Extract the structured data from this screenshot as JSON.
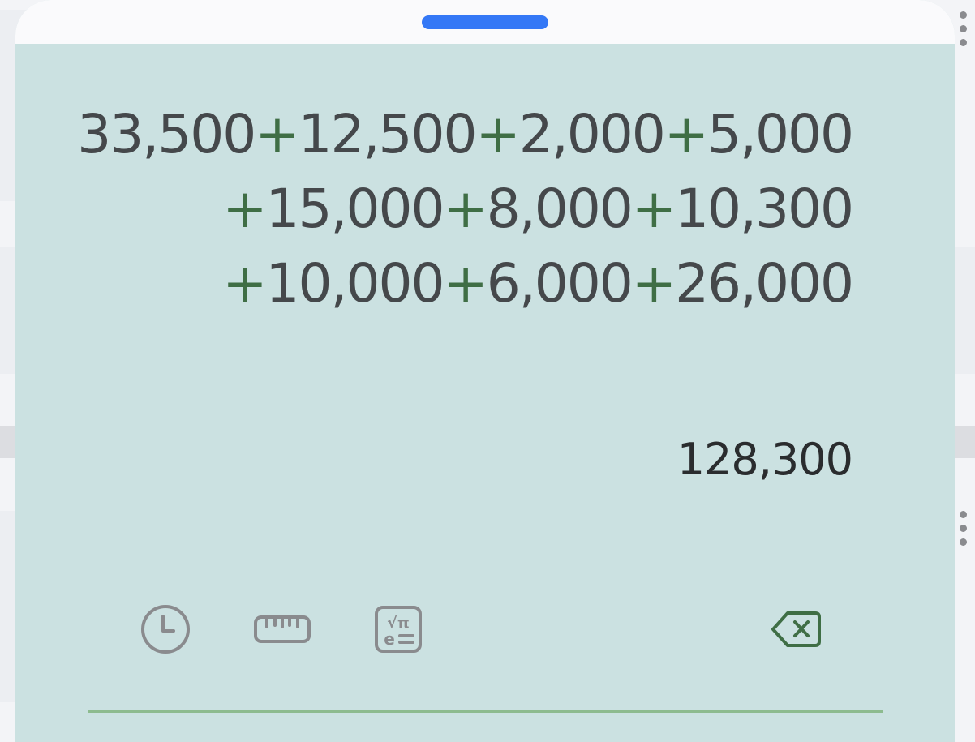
{
  "calculator": {
    "expression_lines": [
      [
        {
          "t": "num",
          "v": "33,500"
        },
        {
          "t": "op",
          "v": "+"
        },
        {
          "t": "num",
          "v": "12,500"
        },
        {
          "t": "op",
          "v": "+"
        },
        {
          "t": "num",
          "v": "2,000"
        },
        {
          "t": "op",
          "v": "+"
        },
        {
          "t": "num",
          "v": "5,000"
        }
      ],
      [
        {
          "t": "op",
          "v": "+"
        },
        {
          "t": "num",
          "v": "15,000"
        },
        {
          "t": "op",
          "v": "+"
        },
        {
          "t": "num",
          "v": "8,000"
        },
        {
          "t": "op",
          "v": "+"
        },
        {
          "t": "num",
          "v": "10,300"
        }
      ],
      [
        {
          "t": "op",
          "v": "+"
        },
        {
          "t": "num",
          "v": "10,000"
        },
        {
          "t": "op",
          "v": "+"
        },
        {
          "t": "num",
          "v": "6,000"
        },
        {
          "t": "op",
          "v": "+"
        },
        {
          "t": "num",
          "v": "26,000"
        }
      ]
    ],
    "result": "128,300"
  },
  "toolbar": {
    "history_icon": "clock-icon",
    "unit_converter_icon": "ruler-icon",
    "scientific_icon": "scientific-functions-icon",
    "backspace_icon": "backspace-icon",
    "scientific_icon_glyphs": {
      "root_pi": "√π",
      "e": "e"
    }
  },
  "colors": {
    "panel_background": "#cbe1e1",
    "operator_green": "#3f6e45",
    "drag_handle_blue": "#3478f6",
    "divider_green": "#8dbb8f"
  }
}
